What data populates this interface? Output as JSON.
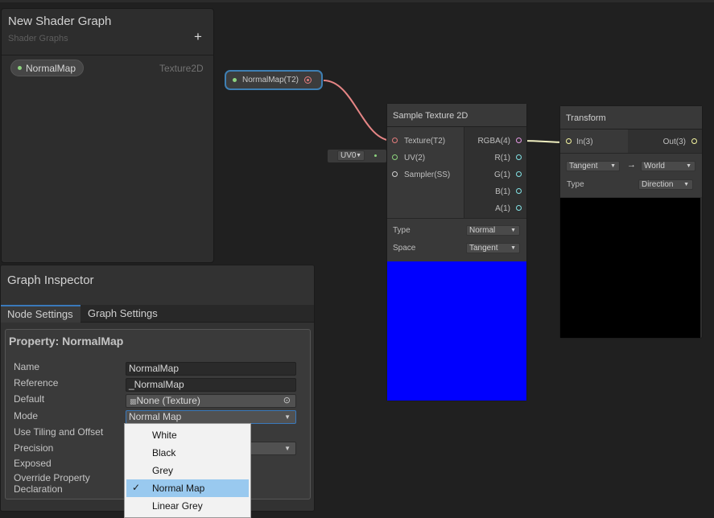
{
  "blackboard": {
    "title": "New Shader Graph",
    "subtitle": "Shader Graphs",
    "add_label": "+",
    "property": {
      "name": "NormalMap",
      "type": "Texture2D"
    }
  },
  "property_node": {
    "label": "NormalMap(T2)"
  },
  "sample_texture": {
    "title": "Sample Texture 2D",
    "inputs": [
      "Texture(T2)",
      "UV(2)",
      "Sampler(SS)"
    ],
    "outputs": [
      "RGBA(4)",
      "R(1)",
      "G(1)",
      "B(1)",
      "A(1)"
    ],
    "type_label": "Type",
    "type_value": "Normal",
    "space_label": "Space",
    "space_value": "Tangent",
    "preview_color": "#0000ff"
  },
  "uv_node": {
    "value": "UV0"
  },
  "transform": {
    "title": "Transform",
    "input": "In(3)",
    "output": "Out(3)",
    "from_value": "Tangent",
    "arrow": "→",
    "to_value": "World",
    "type_label": "Type",
    "type_value": "Direction"
  },
  "inspector": {
    "title": "Graph Inspector",
    "tabs": [
      "Node Settings",
      "Graph Settings"
    ],
    "card_title": "Property: NormalMap",
    "labels": {
      "name": "Name",
      "reference": "Reference",
      "default": "Default",
      "mode": "Mode",
      "tiling": "Use Tiling and Offset",
      "precision": "Precision",
      "exposed": "Exposed",
      "override1": "Override Property",
      "override2": "Declaration"
    },
    "values": {
      "name": "NormalMap",
      "reference": "_NormalMap",
      "default": "None (Texture)",
      "mode": "Normal Map"
    }
  },
  "mode_menu": {
    "items": [
      "White",
      "Black",
      "Grey",
      "Normal Map",
      "Linear Grey"
    ],
    "selected": "Normal Map"
  },
  "colors": {
    "accent": "#3a79bb",
    "texture_port": "#e47c7c",
    "vector_port": "#f5f5a0",
    "float_port": "#84e4e7",
    "uv_port": "#8dd37e",
    "menu_highlight": "#99c9ef"
  }
}
